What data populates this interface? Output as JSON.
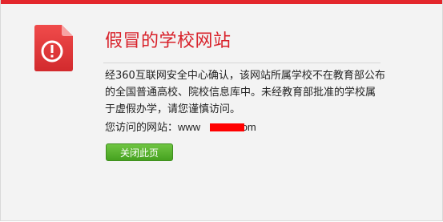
{
  "page": {
    "title": "假冒的学校网站",
    "message": "经360互联网安全中心确认，该网站所属学校不在教育部公布的全国普通高校、院校信息库中。未经教育部批准的学校属于虚假办学，请您谨慎访问。",
    "url_label": "您访问的网站：",
    "url_prefix": "www",
    "url_suffix": "com",
    "close_button": "关闭此页",
    "warning_icon": "warning-document-icon"
  },
  "colors": {
    "accent": "#e3262c",
    "title": "#d8212a",
    "button": "#52ab2a",
    "redaction": "#ff0000"
  }
}
